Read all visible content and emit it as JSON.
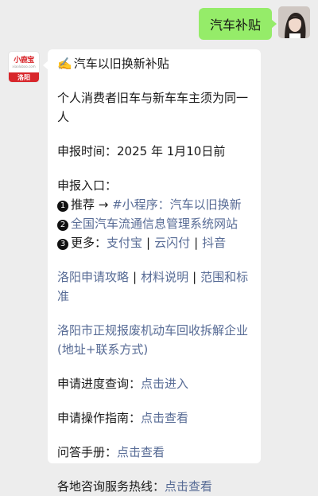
{
  "sent_message": {
    "text": "汽车补贴"
  },
  "bot": {
    "logo_name": "小鹿宝",
    "logo_sub": "xiaolubao.com",
    "logo_city": "洛阳"
  },
  "reply": {
    "title_icon": "✍️",
    "title": "汽车以旧换新补贴",
    "requirement": "个人消费者旧车与新车车主须为同一人",
    "deadline": "申报时间：2025 年 1月10日前",
    "entry_heading": "申报入口：",
    "entries": [
      {
        "marker": "1",
        "lead": "推荐 → ",
        "link": "#小程序：汽车以旧换新"
      },
      {
        "marker": "2",
        "lead": "",
        "link": "全国汽车流通信息管理系统网站"
      },
      {
        "marker": "3",
        "lead": "更多：",
        "links": [
          "支付宝",
          "云闪付",
          "抖音"
        ]
      }
    ],
    "guide_links": [
      "洛阳申请攻略",
      "材料说明",
      "范围和标准"
    ],
    "dismantle_link": "洛阳市正规报废机动车回收拆解企业 (地址+联系方式)",
    "rows": [
      {
        "label": "申请进度查询：",
        "link": "点击进入"
      },
      {
        "label": "申请操作指南：",
        "link": "点击查看"
      },
      {
        "label": "问答手册：",
        "link": "点击查看"
      },
      {
        "label": "各地咨询服务热线：",
        "link": "点击查看"
      }
    ]
  }
}
